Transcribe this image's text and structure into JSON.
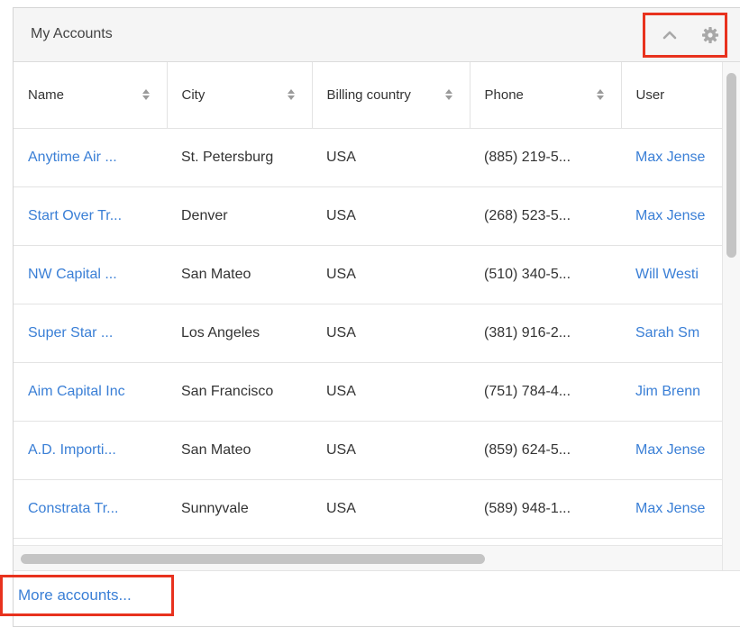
{
  "dashlet": {
    "title": "My Accounts",
    "controls": {
      "collapse_icon": "chevron-up-icon",
      "settings_icon": "gear-icon"
    }
  },
  "table": {
    "columns": [
      "Name",
      "City",
      "Billing country",
      "Phone",
      "User"
    ],
    "rows": [
      {
        "name": "Anytime Air ...",
        "city": "St. Petersburg",
        "country": "USA",
        "phone": "(885) 219-5...",
        "user": "Max Jense"
      },
      {
        "name": "Start Over Tr...",
        "city": "Denver",
        "country": "USA",
        "phone": "(268) 523-5...",
        "user": "Max Jense"
      },
      {
        "name": "NW Capital ...",
        "city": "San Mateo",
        "country": "USA",
        "phone": "(510) 340-5...",
        "user": "Will Westi"
      },
      {
        "name": "Super Star ...",
        "city": "Los Angeles",
        "country": "USA",
        "phone": "(381) 916-2...",
        "user": "Sarah Sm"
      },
      {
        "name": "Aim Capital Inc",
        "city": "San Francisco",
        "country": "USA",
        "phone": "(751) 784-4...",
        "user": "Jim Brenn"
      },
      {
        "name": "A.D. Importi...",
        "city": "San Mateo",
        "country": "USA",
        "phone": "(859) 624-5...",
        "user": "Max Jense"
      },
      {
        "name": "Constrata Tr...",
        "city": "Sunnyvale",
        "country": "USA",
        "phone": "(589) 948-1...",
        "user": "Max Jense"
      }
    ]
  },
  "footer": {
    "more_label": "More accounts..."
  },
  "colors": {
    "link": "#3a7fd6",
    "highlight": "#e8321e",
    "header_bg": "#f5f5f5"
  }
}
